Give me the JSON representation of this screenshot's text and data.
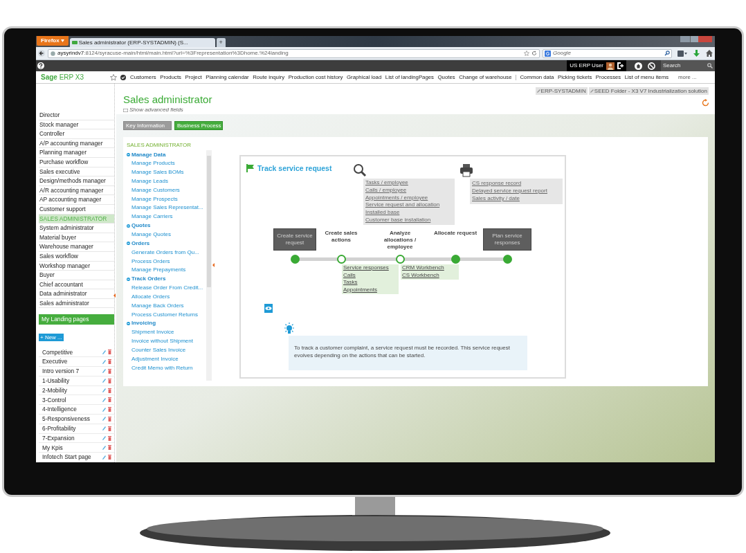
{
  "browser": {
    "menu_button": "Firefox",
    "tab_title": "Sales administrator (ERP-SYSTADMIN) (S...",
    "new_tab": "+",
    "url_host": "aysyrindv7",
    "url_path": ":8124/syracuse-main/html/main.html?url=%3Frepresentation%3Dhome.%24landing",
    "search_placeholder": "Google"
  },
  "topbar": {
    "user": "US ERP User",
    "search_placeholder": "Search"
  },
  "navbar": {
    "logo_brand": "Sage",
    "logo_product": "ERP X3",
    "links": [
      "Customers",
      "Products",
      "Project",
      "Planning calendar",
      "Route inquiry",
      "Production cost history",
      "Graphical load",
      "List of landingPages",
      "Quotes",
      "Change of warehouse"
    ],
    "links_2": [
      "Common data",
      "Picking tickets",
      "Processes",
      "List of menu items"
    ],
    "more": "more ..."
  },
  "roles": [
    {
      "label": "Director",
      "selected": false
    },
    {
      "label": "Stock manager",
      "selected": false
    },
    {
      "label": "Controller",
      "selected": false
    },
    {
      "label": "A/P accounting manager",
      "selected": false
    },
    {
      "label": "Planning manager",
      "selected": false
    },
    {
      "label": "Purchase workflow",
      "selected": false
    },
    {
      "label": "Sales executive",
      "selected": false
    },
    {
      "label": "Design/methods manager",
      "selected": false
    },
    {
      "label": "A/R accounting manager",
      "selected": false
    },
    {
      "label": "AP accounting manager",
      "selected": false
    },
    {
      "label": "Customer support",
      "selected": false
    },
    {
      "label": "SALES ADMINISTRATOR",
      "selected": true
    },
    {
      "label": "System administrator",
      "selected": false
    },
    {
      "label": "Material buyer",
      "selected": false
    },
    {
      "label": "Warehouse manager",
      "selected": false
    },
    {
      "label": "Sales workflow",
      "selected": false
    },
    {
      "label": "Workshop manager",
      "selected": false
    },
    {
      "label": "Buyer",
      "selected": false
    },
    {
      "label": "Chief accountant",
      "selected": false
    },
    {
      "label": "Data administrator",
      "selected": false
    },
    {
      "label": "Sales administrator",
      "selected": false
    }
  ],
  "landing": {
    "title": "My Landing pages",
    "new_button": "+ New ...",
    "pages": [
      "Competitive",
      "Executive",
      "Intro version 7",
      "1-Usability",
      "2-Mobility",
      "3-Control",
      "4-Intelligence",
      "5-Responsiveness",
      "6-Profitability",
      "7-Expansion",
      "My Kpis",
      "Infotech Start page"
    ]
  },
  "page": {
    "title": "Sales administrator",
    "advanced_fields": "Show advanced fields",
    "tags": [
      "ERP-SYSTADMIN",
      "SEED Folder - X3 V7 Industrialization solution"
    ],
    "tabs": [
      {
        "label": "Key Information",
        "selected": false
      },
      {
        "label": "Business Process",
        "selected": true
      }
    ]
  },
  "menu": {
    "title": "SALES ADMINISTRATOR",
    "groups": [
      {
        "label": "Manage Data",
        "children": [
          "Manage Products",
          "Manage Sales BOMs",
          "Manage Leads",
          "Manage Customers",
          "Manage Prospects",
          "Manage Sales Representat...",
          "Manage Carriers"
        ]
      },
      {
        "label": "Quotes",
        "children": [
          "Manage Quotes"
        ]
      },
      {
        "label": "Orders",
        "children": [
          "Generate Orders from Qu...",
          "Process Orders",
          "Manage Prepayments"
        ]
      },
      {
        "label": "Track Orders",
        "children": [
          "Release Order From Credit...",
          "Allocate Orders",
          "Manage Back Orders",
          "Process Customer Returns"
        ]
      },
      {
        "label": "Invoicing",
        "children": [
          "Shipment Invoice",
          "Invoice without Shipment",
          "Counter Sales Invoice",
          "Adjustment Invoice",
          "Credit Memo with Return"
        ]
      }
    ]
  },
  "process": {
    "title": "Track service request",
    "inquiries": [
      "Tasks / employee",
      "Calls / employee",
      "Appointments / employee",
      "Service request and allocation",
      "Installed base",
      "Customer base installation"
    ],
    "reports": [
      "CS response record",
      "Delayed service request report",
      "Sales activity / date"
    ],
    "steps": [
      {
        "label": "Create service request",
        "kind": "box",
        "filled": true
      },
      {
        "label": "Create sales actions",
        "kind": "text",
        "filled": false,
        "links": [
          "Service responses",
          "Calls",
          "Tasks",
          "Appointments"
        ]
      },
      {
        "label": "Analyze allocations / employee",
        "kind": "text",
        "filled": false,
        "links": [
          "CRM Workbench",
          "CS Workbench"
        ]
      },
      {
        "label": "Allocate request",
        "kind": "text",
        "filled": true
      },
      {
        "label": "Plan service responses",
        "kind": "box",
        "filled": true
      }
    ],
    "info": "To track a customer complaint, a service request must be recorded. This service request evolves depending on the actions that can be started."
  }
}
